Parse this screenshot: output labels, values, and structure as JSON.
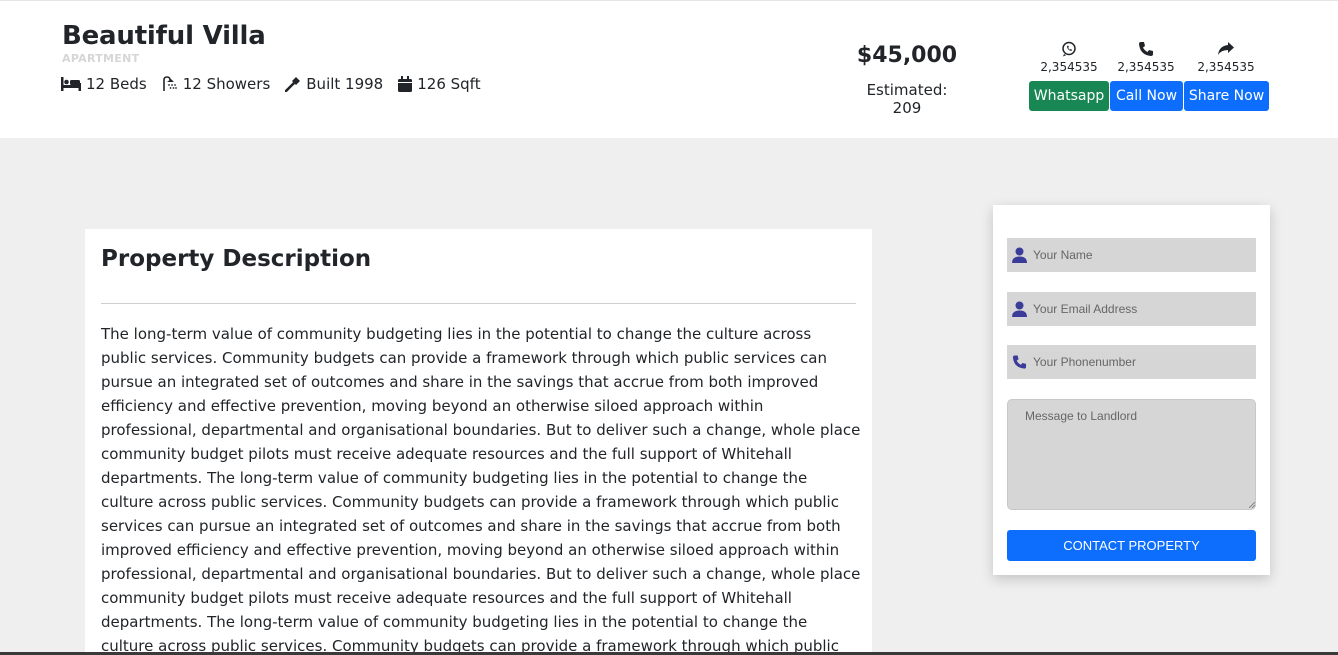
{
  "listing": {
    "title": "Beautiful Villa",
    "type": "APARTMENT",
    "features": [
      {
        "icon": "bed-icon",
        "label": "12 Beds"
      },
      {
        "icon": "shower-icon",
        "label": "12 Showers"
      },
      {
        "icon": "hammer-icon",
        "label": "Built 1998"
      },
      {
        "icon": "calendar-icon",
        "label": "126 Sqft"
      }
    ],
    "price": "$45,000",
    "estimated": "Estimated: 209"
  },
  "contact_actions": [
    {
      "icon": "whatsapp-icon",
      "count": "2,354535",
      "label": "Whatsapp",
      "color": "#198754"
    },
    {
      "icon": "phone-icon",
      "count": "2,354535",
      "label": "Call Now",
      "color": "#0d6efd"
    },
    {
      "icon": "share-icon",
      "count": "2,354535",
      "label": "Share Now",
      "color": "#0d6efd"
    }
  ],
  "description": {
    "title": "Property Description",
    "text": "The long-term value of community budgeting lies in the potential to change the culture across public services. Community budgets can provide a framework through which public services can pursue an integrated set of outcomes and share in the savings that accrue from both improved efficiency and effective prevention, moving beyond an otherwise siloed approach within professional, departmental and organisational boundaries. But to deliver such a change, whole place community budget pilots must receive adequate resources and the full support of Whitehall departments. The long-term value of community budgeting lies in the potential to change the culture across public services. Community budgets can provide a framework through which public services can pursue an integrated set of outcomes and share in the savings that accrue from both improved efficiency and effective prevention, moving beyond an otherwise siloed approach within professional, departmental and organisational boundaries. But to deliver such a change, whole place community budget pilots must receive adequate resources and the full support of Whitehall departments. The long-term value of community budgeting lies in the potential to change the culture across public services. Community budgets can provide a framework through which public services can pursue an integrated set of outcomes and share in the savings that accrue from both"
  },
  "form": {
    "name_placeholder": "Your Name",
    "email_placeholder": "Your Email Address",
    "phone_placeholder": "Your Phonenumber",
    "message_placeholder": "Message to Landlord",
    "submit_label": "CONTACT PROPERTY"
  },
  "colors": {
    "primary": "#0d6efd",
    "success": "#198754",
    "page_bg": "#efefef",
    "field_bg": "#d6d6d6",
    "icon_accent": "#3b3b9a"
  }
}
